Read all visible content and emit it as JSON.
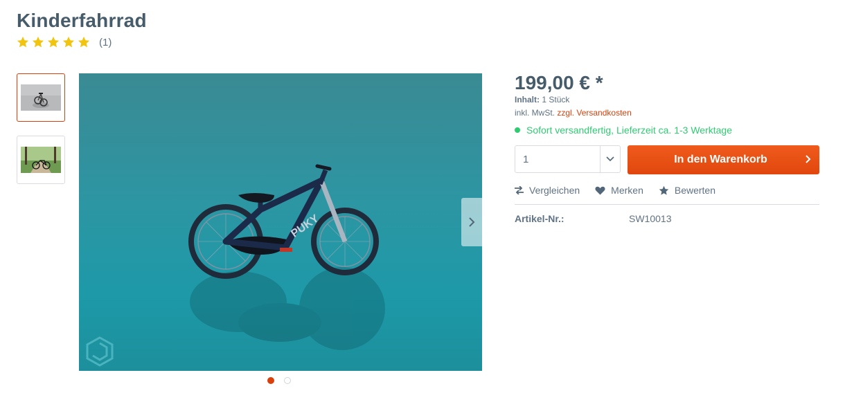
{
  "product": {
    "title": "Kinderfahrrad",
    "rating": {
      "stars": 5,
      "max_stars": 5,
      "count_text": "(1)"
    }
  },
  "gallery": {
    "thumbnails": [
      {
        "name": "thumb-bike-studio",
        "active": true
      },
      {
        "name": "thumb-bike-forest",
        "active": false
      }
    ],
    "dots": [
      {
        "active": true
      },
      {
        "active": false
      }
    ]
  },
  "buybox": {
    "price": "199,00 € *",
    "content_label": "Inhalt:",
    "content_value": "1 Stück",
    "tax_text": "inkl. MwSt.",
    "shipping_link": "zzgl. Versandkosten",
    "delivery": "Sofort versandfertig, Lieferzeit ca. 1-3 Werktage",
    "quantity": "1",
    "cart_button": "In den Warenkorb"
  },
  "actions": {
    "compare": "Vergleichen",
    "remember": "Merken",
    "review": "Bewerten"
  },
  "details": {
    "article_label": "Artikel-Nr.:",
    "article_value": "SW10013"
  },
  "colors": {
    "accent": "#d9400b",
    "star": "#f1c40f",
    "delivery": "#2ecc71",
    "text": "#52667a"
  },
  "icons": [
    "star-icon",
    "chevron-down-icon",
    "chevron-right-icon",
    "compare-arrows-icon",
    "heart-icon",
    "star-outline-icon",
    "brand-logo-icon"
  ]
}
